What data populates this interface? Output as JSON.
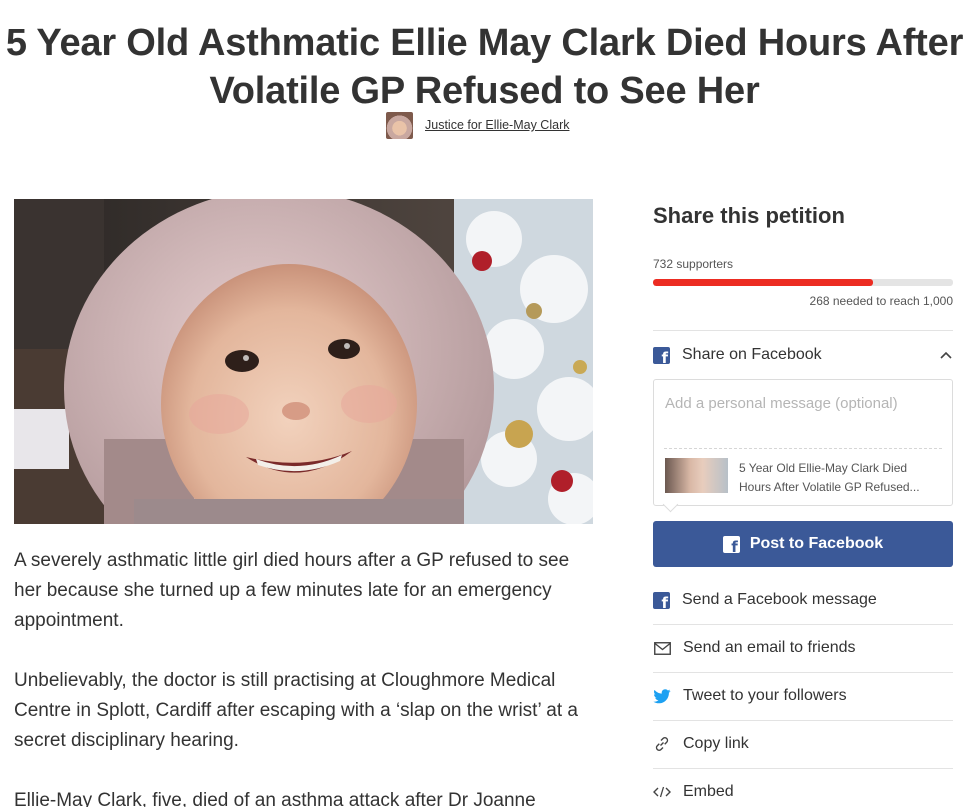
{
  "petition": {
    "title": "5 Year Old Asthmatic Ellie May Clark Died Hours After Volatile GP Refused to See Her",
    "author": "Justice for Ellie-May Clark"
  },
  "body": {
    "paragraphs": [
      "A severely asthmatic little girl died hours after a GP refused to see her because she turned up a few minutes late for an emergency appointment.",
      "Unbelievably, the doctor is still practising at Cloughmore Medical Centre in Splott, Cardiff after escaping with a ‘slap on the wrist’ at a secret disciplinary hearing.",
      "Ellie-May Clark, five, died of an asthma attack after Dr Joanne"
    ]
  },
  "sidebar": {
    "share_title": "Share this petition",
    "supporters_text": "732 supporters",
    "progress_fraction": 0.732,
    "needed_text": "268 needed to reach 1,000",
    "share_facebook_label": "Share on Facebook",
    "message_placeholder": "Add a personal message (optional)",
    "preview_text": "5 Year Old Ellie-May Clark Died Hours After Volatile GP Refused...",
    "post_button_label": "Post to Facebook",
    "actions": [
      {
        "label": "Send a Facebook message",
        "icon": "facebook-icon"
      },
      {
        "label": "Send an email to friends",
        "icon": "email-icon"
      },
      {
        "label": "Tweet to your followers",
        "icon": "twitter-icon"
      },
      {
        "label": "Copy link",
        "icon": "link-icon"
      },
      {
        "label": "Embed",
        "icon": "embed-icon"
      }
    ]
  },
  "colors": {
    "progress_fill": "#ec2c22",
    "facebook_blue": "#3b5998",
    "twitter_blue": "#1da1f2"
  }
}
